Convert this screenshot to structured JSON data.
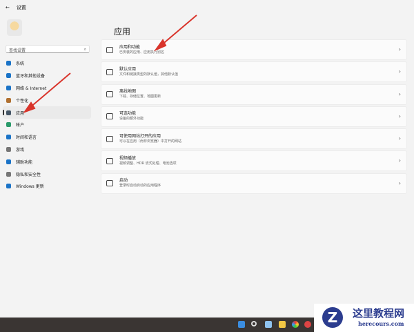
{
  "window": {
    "back": "←",
    "title": "设置"
  },
  "search": {
    "placeholder": "查找设置",
    "icon": "⌕"
  },
  "sidebar": {
    "items": [
      {
        "label": "系统",
        "color": "#1a73c7"
      },
      {
        "label": "蓝牙和其他设备",
        "color": "#1a73c7"
      },
      {
        "label": "网络 & Internet",
        "color": "#1a73c7"
      },
      {
        "label": "个性化",
        "color": "#b07030"
      },
      {
        "label": "应用",
        "color": "#445566"
      },
      {
        "label": "帐户",
        "color": "#2a9a6a"
      },
      {
        "label": "时间和语言",
        "color": "#1a73c7"
      },
      {
        "label": "游戏",
        "color": "#777777"
      },
      {
        "label": "辅助功能",
        "color": "#1a73c7"
      },
      {
        "label": "隐私和安全性",
        "color": "#777777"
      },
      {
        "label": "Windows 更新",
        "color": "#1a73c7"
      }
    ],
    "selected": "应用"
  },
  "main": {
    "title": "应用",
    "cards": [
      {
        "title": "应用和功能",
        "subtitle": "已安装的应用、应用执行别名"
      },
      {
        "title": "默认应用",
        "subtitle": "文件和链接类型的默认值，其他默认值"
      },
      {
        "title": "离线地图",
        "subtitle": "下载、存储位置、地图更新"
      },
      {
        "title": "可选功能",
        "subtitle": "设备的额外功能"
      },
      {
        "title": "可使用网站打开的应用",
        "subtitle": "可以在应用（而非浏览器）中打开的网站"
      },
      {
        "title": "视频播放",
        "subtitle": "视频调整、HDR 流式处理、电池选项"
      },
      {
        "title": "启动",
        "subtitle": "登录时自动启动的应用程序"
      }
    ],
    "chevron": "›"
  },
  "watermark": {
    "logo": "Z",
    "title": "这里教程网",
    "url": "herecours.com"
  }
}
